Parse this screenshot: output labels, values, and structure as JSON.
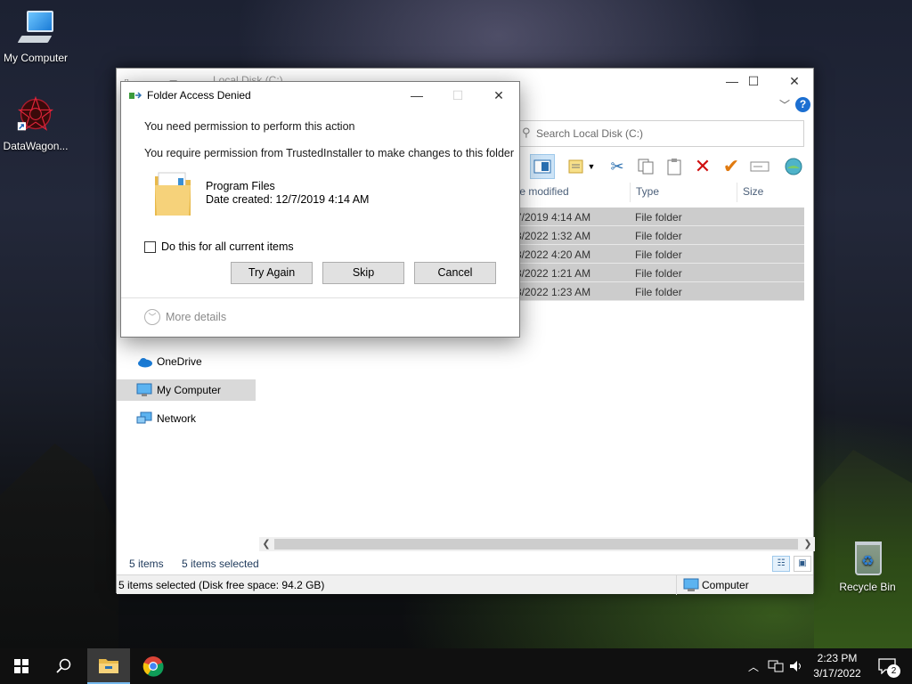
{
  "desktop": {
    "icons": [
      {
        "label": "My Computer"
      },
      {
        "label": "DataWagon..."
      },
      {
        "label": "Recycle Bin"
      }
    ]
  },
  "explorer": {
    "title": "Local Disk (C:)",
    "search_placeholder": "Search Local Disk (C:)",
    "columns": {
      "date": "te modified",
      "type": "Type",
      "size": "Size"
    },
    "rows": [
      {
        "date": "7/2019 4:14 AM",
        "type": "File folder"
      },
      {
        "date": "3/2022 1:32 AM",
        "type": "File folder"
      },
      {
        "date": "3/2022 4:20 AM",
        "type": "File folder"
      },
      {
        "date": "3/2022 1:21 AM",
        "type": "File folder"
      },
      {
        "date": "3/2022 1:23 AM",
        "type": "File folder"
      }
    ],
    "nav": [
      {
        "label": "OneDrive"
      },
      {
        "label": "My Computer"
      },
      {
        "label": "Network"
      }
    ],
    "status": {
      "items": "5 items",
      "selected": "5 items selected"
    },
    "details_bar": {
      "left": "5 items selected (Disk free space: 94.2 GB)",
      "right": "Computer"
    }
  },
  "dialog": {
    "title": "Folder Access Denied",
    "message1": "You need permission to perform this action",
    "message2": "You require permission from TrustedInstaller to make changes to this folder",
    "item_name": "Program Files",
    "item_date": "Date created: 12/7/2019 4:14 AM",
    "checkbox_label": "Do this for all current items",
    "buttons": {
      "try_again": "Try Again",
      "skip": "Skip",
      "cancel": "Cancel"
    },
    "more_details": "More details"
  },
  "taskbar": {
    "time": "2:23 PM",
    "date": "3/17/2022",
    "notification_count": "2"
  }
}
